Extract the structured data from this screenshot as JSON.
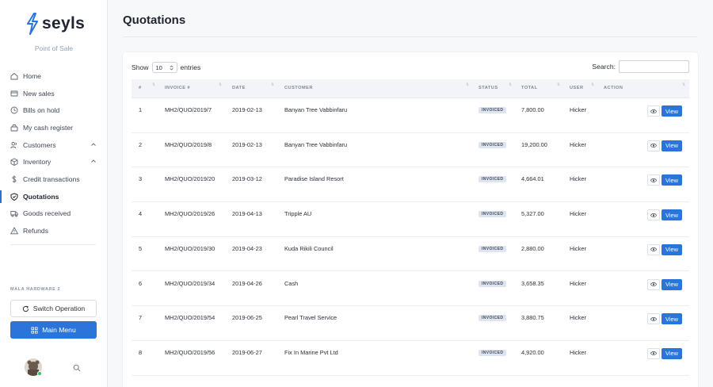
{
  "brand": {
    "name": "seyls",
    "subtitle": "Point of Sale",
    "accent": "#2b74d9"
  },
  "sidebar": {
    "items": [
      {
        "label": "Home",
        "icon": "home-icon",
        "active": false
      },
      {
        "label": "New sales",
        "icon": "card-icon",
        "active": false
      },
      {
        "label": "Bills on hold",
        "icon": "clock-icon",
        "active": false
      },
      {
        "label": "My cash register",
        "icon": "register-icon",
        "active": false
      },
      {
        "label": "Customers",
        "icon": "users-icon",
        "active": false,
        "chevron": true
      },
      {
        "label": "Inventory",
        "icon": "box-icon",
        "active": false,
        "chevron": true
      },
      {
        "label": "Credit transactions",
        "icon": "dollar-icon",
        "active": false
      },
      {
        "label": "Quotations",
        "icon": "shield-icon",
        "active": true
      },
      {
        "label": "Goods received",
        "icon": "truck-icon",
        "active": false
      },
      {
        "label": "Refunds",
        "icon": "alert-icon",
        "active": false
      }
    ],
    "store_label": "MALA HARDWARE 2",
    "switch_label": "Switch Operation",
    "main_menu_label": "Main Menu"
  },
  "page": {
    "title": "Quotations"
  },
  "table_controls": {
    "show_label": "Show",
    "entries_value": "10",
    "entries_label": "entries",
    "search_label": "Search:"
  },
  "columns": [
    "#",
    "INVOICE #",
    "DATE",
    "CUSTOMER",
    "STATUS",
    "TOTAL",
    "USER",
    "ACTION"
  ],
  "rows": [
    {
      "num": "1",
      "invoice": "MH2/QUO/2019/7",
      "date": "2019-02-13",
      "customer": "Banyan Tree Vabbinfaru",
      "status": "INVOICED",
      "total": "7,800.00",
      "user": "Hicker",
      "action": "View"
    },
    {
      "num": "2",
      "invoice": "MH2/QUO/2019/8",
      "date": "2019-02-13",
      "customer": "Banyan Tree Vabbinfaru",
      "status": "INVOICED",
      "total": "19,200.00",
      "user": "Hicker",
      "action": "View"
    },
    {
      "num": "3",
      "invoice": "MH2/QUO/2019/20",
      "date": "2019-03-12",
      "customer": "Paradise Island Resort",
      "status": "INVOICED",
      "total": "4,664.01",
      "user": "Hicker",
      "action": "View"
    },
    {
      "num": "4",
      "invoice": "MH2/QUO/2019/26",
      "date": "2019-04-13",
      "customer": "Tripple AU",
      "status": "INVOICED",
      "total": "5,327.00",
      "user": "Hicker",
      "action": "View"
    },
    {
      "num": "5",
      "invoice": "MH2/QUO/2019/30",
      "date": "2019-04-23",
      "customer": "Kuda Rikili Council",
      "status": "INVOICED",
      "total": "2,880.00",
      "user": "Hicker",
      "action": "View"
    },
    {
      "num": "6",
      "invoice": "MH2/QUO/2019/34",
      "date": "2019-04-26",
      "customer": "Cash",
      "status": "INVOICED",
      "total": "3,658.35",
      "user": "Hicker",
      "action": "View"
    },
    {
      "num": "7",
      "invoice": "MH2/QUO/2019/54",
      "date": "2019-06-25",
      "customer": "Pearl Travel Service",
      "status": "INVOICED",
      "total": "3,880.75",
      "user": "Hicker",
      "action": "View"
    },
    {
      "num": "8",
      "invoice": "MH2/QUO/2019/56",
      "date": "2019-06-27",
      "customer": "Fix In Marine Pvt Ltd",
      "status": "INVOICED",
      "total": "4,920.00",
      "user": "Hicker",
      "action": "View"
    }
  ]
}
